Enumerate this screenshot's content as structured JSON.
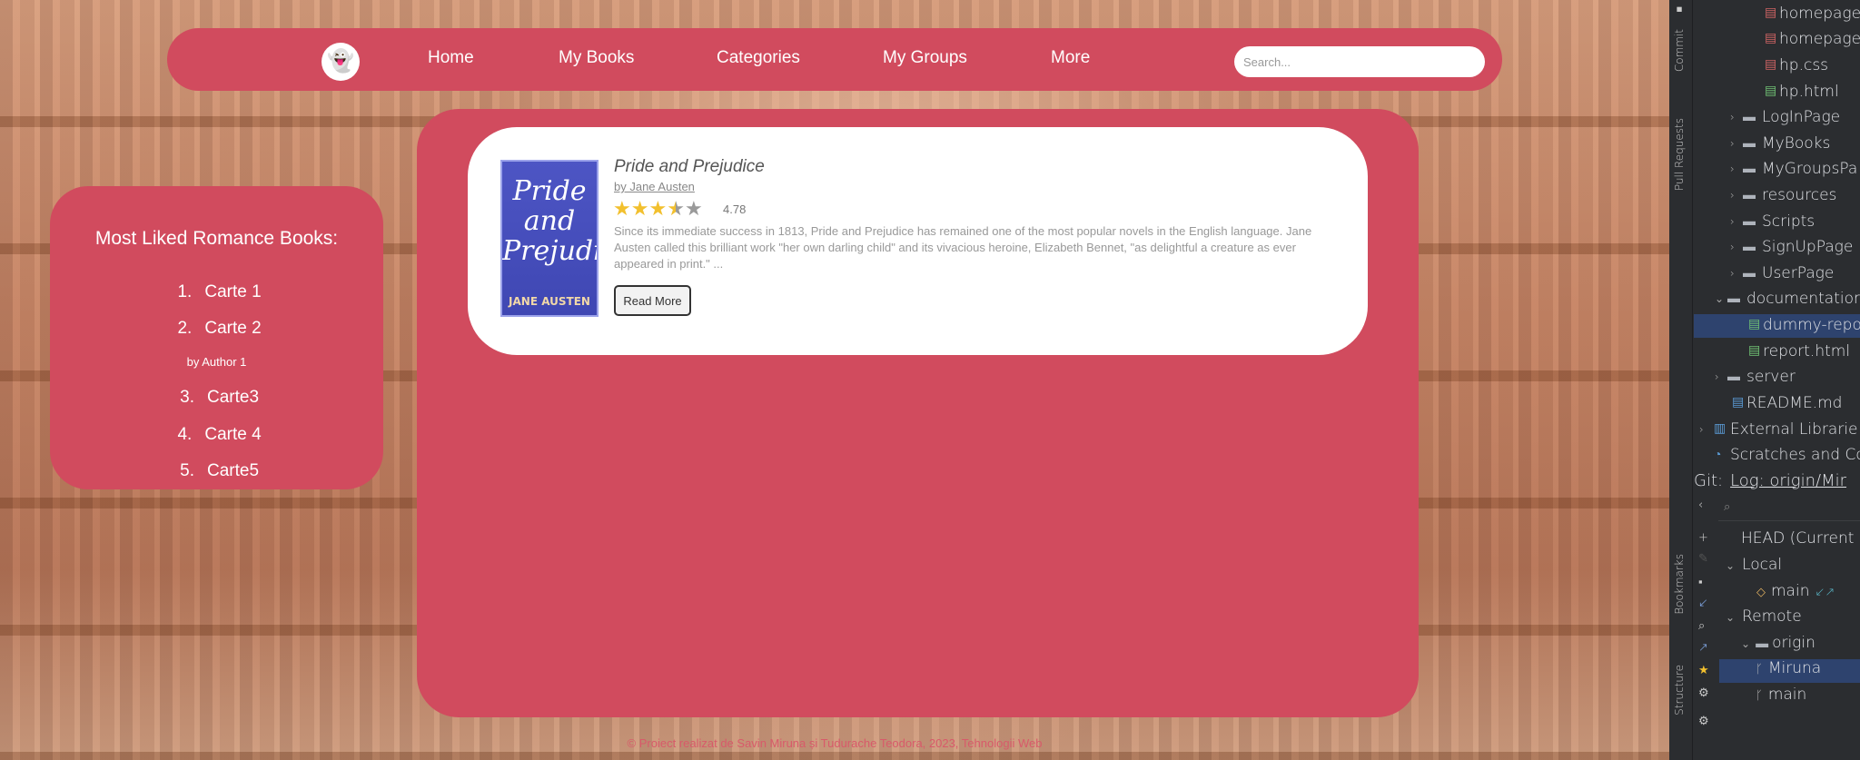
{
  "site": {
    "nav": {
      "links": [
        "Home",
        "My Books",
        "Categories",
        "My Groups",
        "More"
      ],
      "search_placeholder": "Search..."
    },
    "sidebar": {
      "title": "Most Liked Romance Books:",
      "items": [
        {
          "num": "1.",
          "label": "Carte 1"
        },
        {
          "num": "2.",
          "label": "Carte 2"
        },
        {
          "num": "3.",
          "label": "Carte3"
        },
        {
          "num": "4.",
          "label": "Carte 4"
        },
        {
          "num": "5.",
          "label": "Carte5"
        }
      ],
      "author_note": "by Author 1"
    },
    "book": {
      "cover_title": "Pride and Prejudice",
      "cover_author": "JANE AUSTEN",
      "title": "Pride and Prejudice",
      "author": "by Jane Austen",
      "stars": 3.5,
      "rating": "4.78",
      "description": "Since its immediate success in 1813, Pride and Prejudice has remained one of the most popular novels in the English language. Jane Austen called this brilliant work \"her own darling child\" and its vivacious heroine, Elizabeth Bennet, \"as delightful a creature as ever appeared in print.\" ...",
      "read_more": "Read More"
    },
    "footer": "© Proiect realizat de Savin Miruna și Tudurache Teodora, 2023, Tehnologii Web"
  },
  "ide": {
    "side_tabs": [
      "Commit",
      "Pull Requests",
      "Bookmarks",
      "Structure"
    ],
    "tree": [
      {
        "label": "homepage",
        "type": "file-red"
      },
      {
        "label": "homepage",
        "type": "file-red"
      },
      {
        "label": "hp.css",
        "type": "file-red"
      },
      {
        "label": "hp.html",
        "type": "file"
      },
      {
        "label": "LogInPage",
        "type": "folder"
      },
      {
        "label": "MyBooks",
        "type": "folder"
      },
      {
        "label": "MyGroupsPa",
        "type": "folder"
      },
      {
        "label": "resources",
        "type": "folder"
      },
      {
        "label": "Scripts",
        "type": "folder"
      },
      {
        "label": "SignUpPage",
        "type": "folder"
      },
      {
        "label": "UserPage",
        "type": "folder"
      },
      {
        "label": "documentation",
        "type": "folder-open"
      },
      {
        "label": "dummy-repo",
        "type": "file"
      },
      {
        "label": "report.html",
        "type": "file"
      },
      {
        "label": "server",
        "type": "folder"
      },
      {
        "label": "README.md",
        "type": "md"
      },
      {
        "label": "External Librarie",
        "type": "lib"
      },
      {
        "label": "Scratches and Co",
        "type": "scratch"
      }
    ],
    "git": {
      "label": "Git:",
      "log": "Log: origin/Mir",
      "rows": [
        "HEAD (Current",
        "Local",
        "main",
        "Remote",
        "origin",
        "Miruna",
        "main"
      ]
    }
  }
}
